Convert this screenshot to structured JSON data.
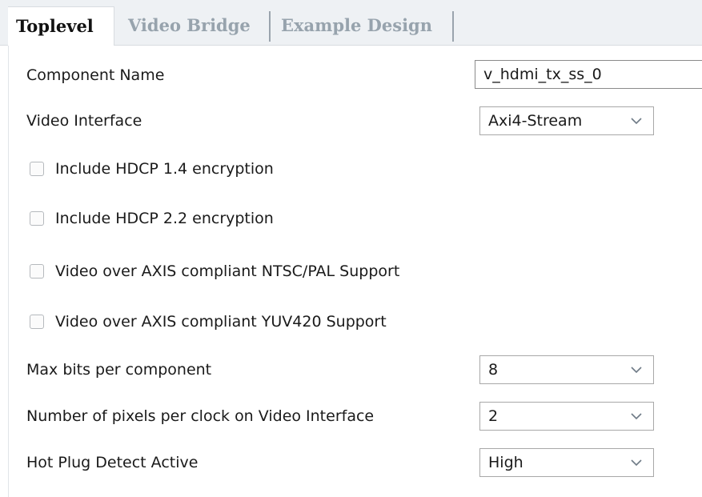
{
  "tabs": [
    {
      "label": "Toplevel",
      "active": true
    },
    {
      "label": "Video Bridge",
      "active": false
    },
    {
      "label": "Example Design",
      "active": false
    }
  ],
  "form": {
    "component_name": {
      "label": "Component Name",
      "value": "v_hdmi_tx_ss_0"
    },
    "video_interface": {
      "label": "Video Interface",
      "value": "Axi4-Stream"
    },
    "checkboxes": [
      {
        "label": "Include HDCP 1.4 encryption",
        "checked": false
      },
      {
        "label": "Include HDCP 2.2 encryption",
        "checked": false
      },
      {
        "label": "Video over AXIS compliant NTSC/PAL Support",
        "checked": false
      },
      {
        "label": "Video over AXIS compliant YUV420 Support",
        "checked": false
      }
    ],
    "max_bits": {
      "label": "Max bits per component",
      "value": "8"
    },
    "pixels_per_clock": {
      "label": "Number of pixels per clock on Video Interface",
      "value": "2"
    },
    "hot_plug": {
      "label": "Hot Plug Detect Active",
      "value": "High"
    }
  },
  "icons": {
    "dropdown": "chevron-down-icon"
  },
  "colors": {
    "tabbar_bg": "#eef1f4",
    "inactive_tab_text": "#97a3ad",
    "checkbox_border": "#b5b9bd"
  }
}
